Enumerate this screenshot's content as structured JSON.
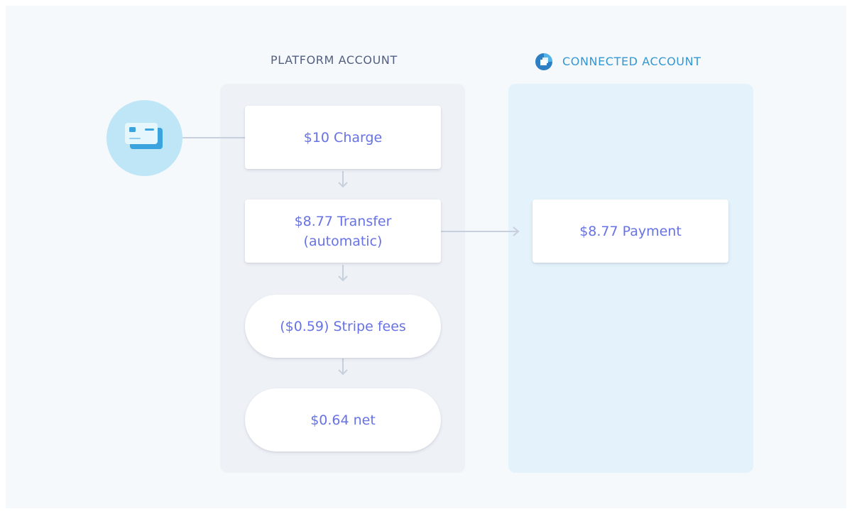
{
  "columns": {
    "platform": {
      "label": "PLATFORM ACCOUNT"
    },
    "connected": {
      "label": "CONNECTED ACCOUNT"
    }
  },
  "nodes": {
    "charge": "$10 Charge",
    "transfer_line1": "$8.77 Transfer",
    "transfer_line2": "(automatic)",
    "fees": "($0.59) Stripe fees",
    "net": "$0.64 net",
    "payment": "$8.77 Payment"
  },
  "colors": {
    "node_text": "#6772e5",
    "platform_panel": "#eef1f6",
    "connected_panel": "#e4f2fb",
    "connected_header": "#3297d3",
    "platform_header": "#525f7f",
    "card_circle": "#bfe6f6",
    "connector": "#c7d0dc"
  },
  "icons": {
    "card": "credit-card-icon",
    "connected_logo": "connected-account-logo-icon"
  }
}
